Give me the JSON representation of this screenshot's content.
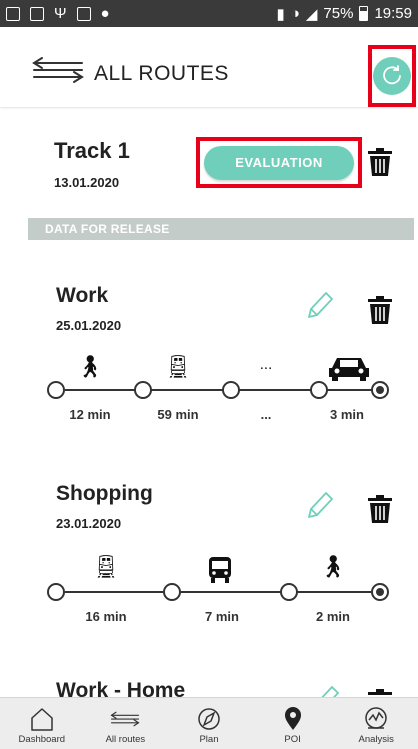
{
  "statusbar": {
    "battery": "75%",
    "time": "19:59"
  },
  "header": {
    "title": "ALL ROUTES",
    "menu_icon": "swap-arrows-icon",
    "refresh_icon": "refresh-icon"
  },
  "track": {
    "title": "Track 1",
    "date": "13.01.2020",
    "evaluation_label": "EVALUATION"
  },
  "section": {
    "label": "DATA FOR RELEASE"
  },
  "routes": [
    {
      "title": "Work",
      "date": "25.01.2020",
      "legs": [
        {
          "icon": "walk-icon",
          "duration": "12 min"
        },
        {
          "icon": "train-icon",
          "duration": "59 min"
        },
        {
          "icon": "ellipsis",
          "duration": "..."
        },
        {
          "icon": "car-icon",
          "duration": "3 min"
        }
      ]
    },
    {
      "title": "Shopping",
      "date": "23.01.2020",
      "legs": [
        {
          "icon": "train-icon",
          "duration": "16 min"
        },
        {
          "icon": "bus-icon",
          "duration": "7 min"
        },
        {
          "icon": "walk-icon",
          "duration": "2 min"
        }
      ]
    },
    {
      "title": "Work - Home"
    }
  ],
  "timeline_ellipsis": "...",
  "nav": [
    {
      "label": "Dashboard",
      "icon": "home-icon"
    },
    {
      "label": "All routes",
      "icon": "swap-arrows-icon"
    },
    {
      "label": "Plan",
      "icon": "compass-icon"
    },
    {
      "label": "POI",
      "icon": "location-pin-icon"
    },
    {
      "label": "Analysis",
      "icon": "analysis-icon"
    }
  ],
  "colors": {
    "accent": "#6fcfba",
    "highlight": "#e8001b",
    "section_bar": "#c4ccca",
    "status_bar": "#3a3a3a"
  }
}
